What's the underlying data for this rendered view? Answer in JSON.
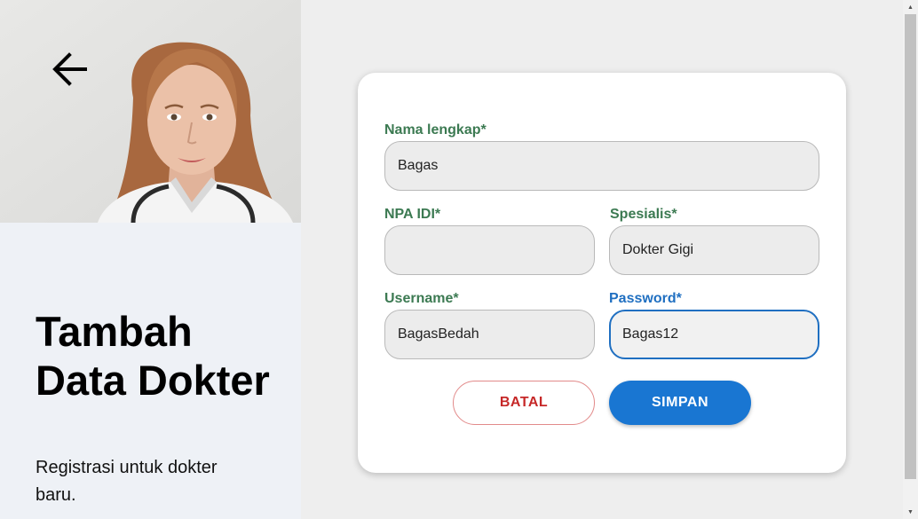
{
  "sidebar": {
    "title": "Tambah Data Dokter",
    "subtitle": "Registrasi untuk dokter baru."
  },
  "form": {
    "fullname": {
      "label": "Nama lengkap*",
      "value": "Bagas"
    },
    "npa": {
      "label": "NPA IDI*",
      "value": ""
    },
    "specialty": {
      "label": "Spesialis*",
      "value": "Dokter Gigi"
    },
    "username": {
      "label": "Username*",
      "value": "BagasBedah"
    },
    "password": {
      "label": "Password*",
      "value": "Bagas12"
    }
  },
  "buttons": {
    "cancel": "BATAL",
    "save": "SIMPAN"
  },
  "icons": {
    "back": "arrow-left-icon",
    "scroll_up": "triangle-up-icon",
    "scroll_down": "triangle-down-icon"
  },
  "colors": {
    "label_green": "#3c7a52",
    "focus_blue": "#1f6fc1",
    "save_bg": "#1976d2",
    "cancel_red": "#c62828"
  }
}
